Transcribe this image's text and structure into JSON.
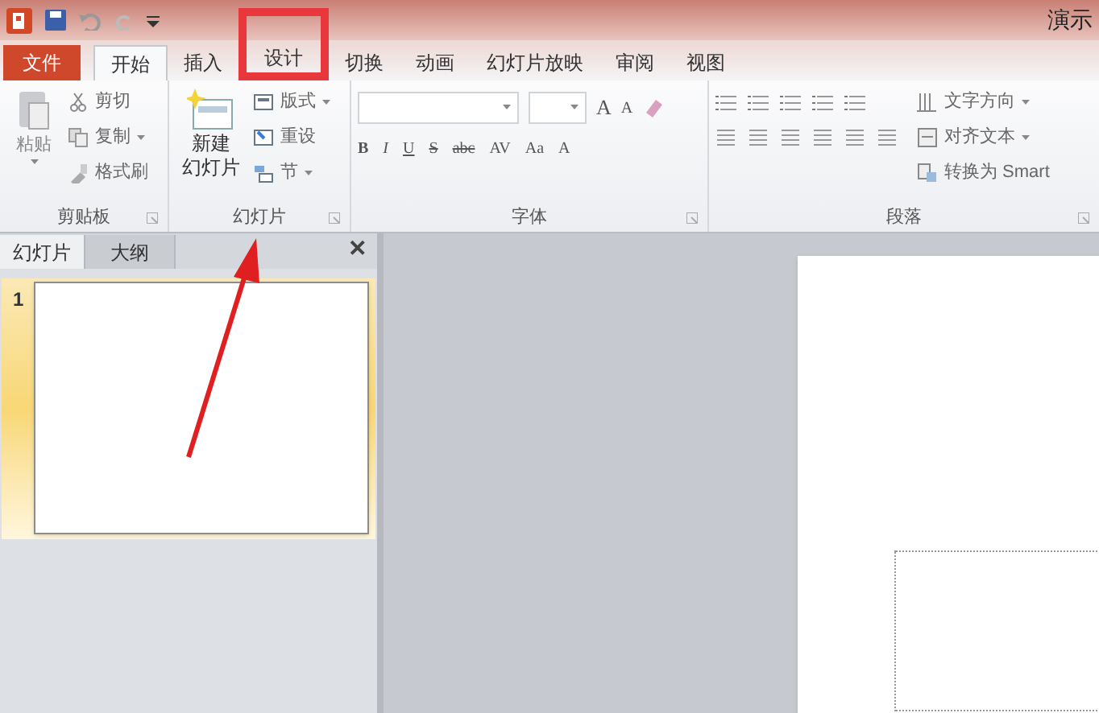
{
  "window": {
    "title": "演示"
  },
  "tabs": [
    {
      "label": "文件",
      "kind": "file",
      "selected": false,
      "highlighted": false
    },
    {
      "label": "开始",
      "kind": "tab",
      "selected": true,
      "highlighted": false
    },
    {
      "label": "插入",
      "kind": "tab",
      "selected": false,
      "highlighted": false
    },
    {
      "label": "设计",
      "kind": "tab",
      "selected": false,
      "highlighted": true
    },
    {
      "label": "切换",
      "kind": "tab",
      "selected": false,
      "highlighted": false
    },
    {
      "label": "动画",
      "kind": "tab",
      "selected": false,
      "highlighted": false
    },
    {
      "label": "幻灯片放映",
      "kind": "tab",
      "selected": false,
      "highlighted": false
    },
    {
      "label": "审阅",
      "kind": "tab",
      "selected": false,
      "highlighted": false
    },
    {
      "label": "视图",
      "kind": "tab",
      "selected": false,
      "highlighted": false
    }
  ],
  "clipboard": {
    "title": "剪贴板",
    "paste": "粘贴",
    "items": [
      {
        "label": "剪切",
        "dropdown": false
      },
      {
        "label": "复制",
        "dropdown": true
      },
      {
        "label": "格式刷",
        "dropdown": false
      }
    ]
  },
  "slides_group": {
    "title": "幻灯片",
    "new_slide": [
      "新建",
      "幻灯片"
    ],
    "items": [
      {
        "label": "版式",
        "dropdown": true
      },
      {
        "label": "重设",
        "dropdown": false
      },
      {
        "label": "节",
        "dropdown": true
      }
    ]
  },
  "font": {
    "title": "字体",
    "row1": [
      "A",
      "A"
    ],
    "row2": [
      "B",
      "I",
      "U",
      "S",
      "abc",
      "AV",
      "Aa",
      "A"
    ]
  },
  "paragraph": {
    "title": "段落",
    "items": [
      {
        "label": "文字方向",
        "dropdown": true
      },
      {
        "label": "对齐文本",
        "dropdown": true
      },
      {
        "label": "转换为 Smart",
        "dropdown": false
      }
    ]
  },
  "pane": {
    "tabs": [
      {
        "label": "幻灯片",
        "selected": true
      },
      {
        "label": "大纲",
        "selected": false
      }
    ],
    "close": "✕",
    "slides": [
      {
        "number": "1",
        "selected": true
      }
    ]
  }
}
